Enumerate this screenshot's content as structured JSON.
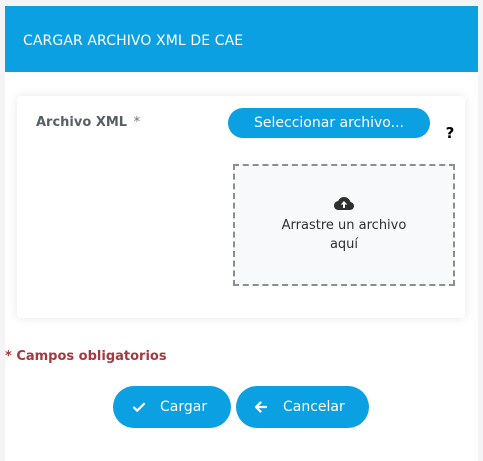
{
  "dialog": {
    "title": "CARGAR ARCHIVO XML DE CAE"
  },
  "form": {
    "field_label": "Archivo XML",
    "required_mark": "*",
    "select_file_label": "Seleccionar archivo...",
    "help_icon": "question-mark-icon",
    "help_text": "?",
    "dropzone": {
      "icon": "cloud-upload-icon",
      "line_1": "Arrastre un archivo",
      "line_2": "aquí"
    }
  },
  "required_note": "* Campos obligatorios",
  "actions": {
    "load_label": "Cargar",
    "load_icon": "check-icon",
    "cancel_label": "Cancelar",
    "cancel_icon": "arrow-left-icon"
  },
  "colors": {
    "accent": "#0aa0e2",
    "header_text": "#ffffff",
    "required_note": "#a6383f",
    "dropzone_border": "#8e8e8e",
    "dropzone_bg": "#f8f9fb"
  }
}
